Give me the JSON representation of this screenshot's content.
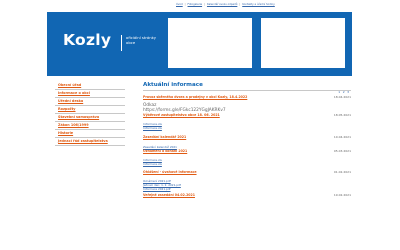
{
  "top_links": [
    "Úvod",
    "Fotogalerie",
    "Kalendář svozu odpadů",
    "Kontakty a úřední hodiny"
  ],
  "header": {
    "site_name": "Kozly",
    "tagline": "oficiální stránky obce",
    "colors": {
      "header_bg": "#1166b3",
      "link_orange": "#e05a12"
    }
  },
  "sidebar": {
    "items": [
      "Obecní úřad",
      "Informace o obci",
      "Úřední deska",
      "Rozpočty",
      "Stavební samospráva",
      "Zákon 106/1999",
      "Historie",
      "Jednací řád zastupitelstva"
    ]
  },
  "main": {
    "title": "Aktuální informace",
    "pager": [
      "1",
      "2",
      "3"
    ],
    "articles": [
      {
        "title": "Provoz sběrného dvora a prodejny v obci Kozly, 18.4.2022",
        "date": "18.04.2021"
      },
      {
        "odkaz_label": "Odkaz",
        "odkaz_url": "https://forms.gle/FGkc122YGgJAKRKv7"
      },
      {
        "title": "Výběrové zastupitelstvo obce 18. 06. 2021",
        "date": "18.05.2021",
        "attachments": [
          "Informace.xls",
          "Informace.xls"
        ]
      },
      {
        "title": "Zasedání kalendář 2021",
        "date": "10.04.2021",
        "attachments": [
          "Zasedání kalendář 2021"
        ]
      },
      {
        "title": "Oznámení o konání 2021",
        "date": "05.03.2021",
        "attachments": [
          "Informace.xls",
          "Informace.xls"
        ]
      },
      {
        "title": "Ohlášení - úvahové informace",
        "date": "01.02.2021",
        "attachments": [
          "Oznámení 2021.pdf",
          "Jednací den: 1. 2. 2021.pdf",
          "Informace 2021.pdf"
        ]
      },
      {
        "title": "Veřejné zasedání 04.02.2021",
        "date": "19.02.2021"
      }
    ]
  }
}
